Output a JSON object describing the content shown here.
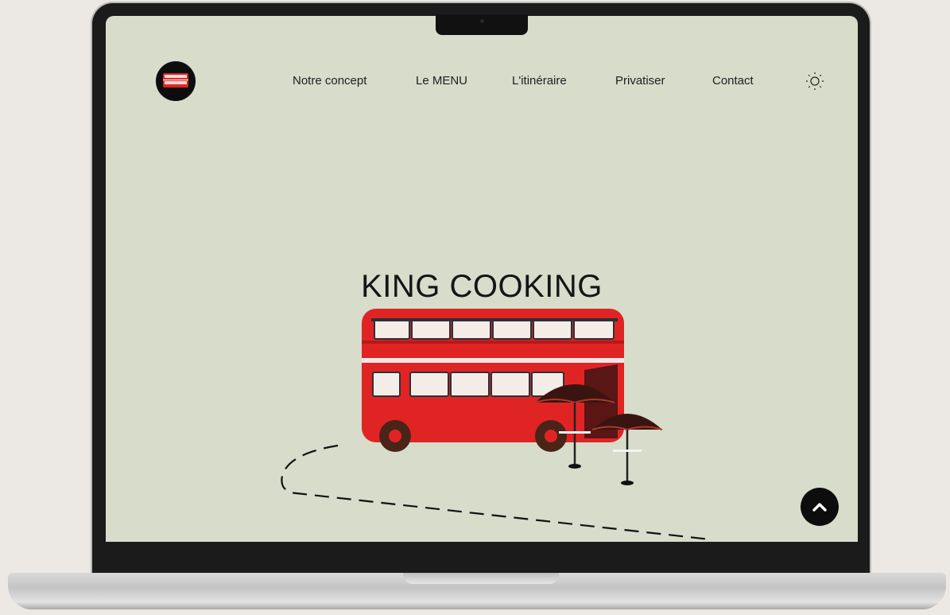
{
  "brand": {
    "logo_icon": "bus-logo-icon",
    "colors": {
      "background": "#d7dccb",
      "bus_red": "#e02424",
      "text": "#1e1e1e"
    }
  },
  "nav": {
    "items": [
      {
        "label": "Notre concept"
      },
      {
        "label": "Le MENU"
      },
      {
        "label": "L'itinéraire"
      },
      {
        "label": "Privatiser"
      },
      {
        "label": "Contact"
      }
    ],
    "theme_toggle_icon": "sun-icon"
  },
  "hero": {
    "title": "KING COOKING",
    "illustration": "double-decker-bus-illustration"
  },
  "scroll_top_icon": "chevron-up-icon"
}
